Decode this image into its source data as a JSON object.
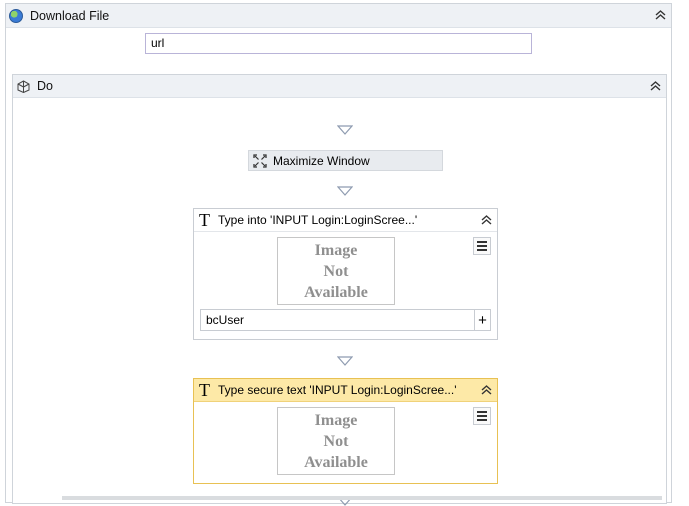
{
  "download_file": {
    "title": "Download File",
    "url_value": "url"
  },
  "do_section": {
    "title": "Do"
  },
  "maximize_window": {
    "label": "Maximize Window"
  },
  "type_into": {
    "title": "Type into 'INPUT  Login:LoginScree...'",
    "image_placeholder": [
      "Image",
      "Not",
      "Available"
    ],
    "text_value": "bcUser"
  },
  "type_secure": {
    "title": "Type secure text 'INPUT  Login:LoginScree...'",
    "image_placeholder": [
      "Image",
      "Not",
      "Available"
    ]
  },
  "icons": {
    "outer": "globe-icon",
    "do": "sequence-icon",
    "maximize": "maximize-icon",
    "type": "text-t-icon",
    "collapse": "double-chevron-up-icon",
    "menu": "hamburger-icon",
    "plus": "plus-icon",
    "flow_arrow": "triangle-down-icon"
  },
  "colors": {
    "header_bg": "#eef1f5",
    "selected_header": "#fde9a7",
    "selected_border": "#e8c153",
    "arrow": "#8e9bb0"
  }
}
